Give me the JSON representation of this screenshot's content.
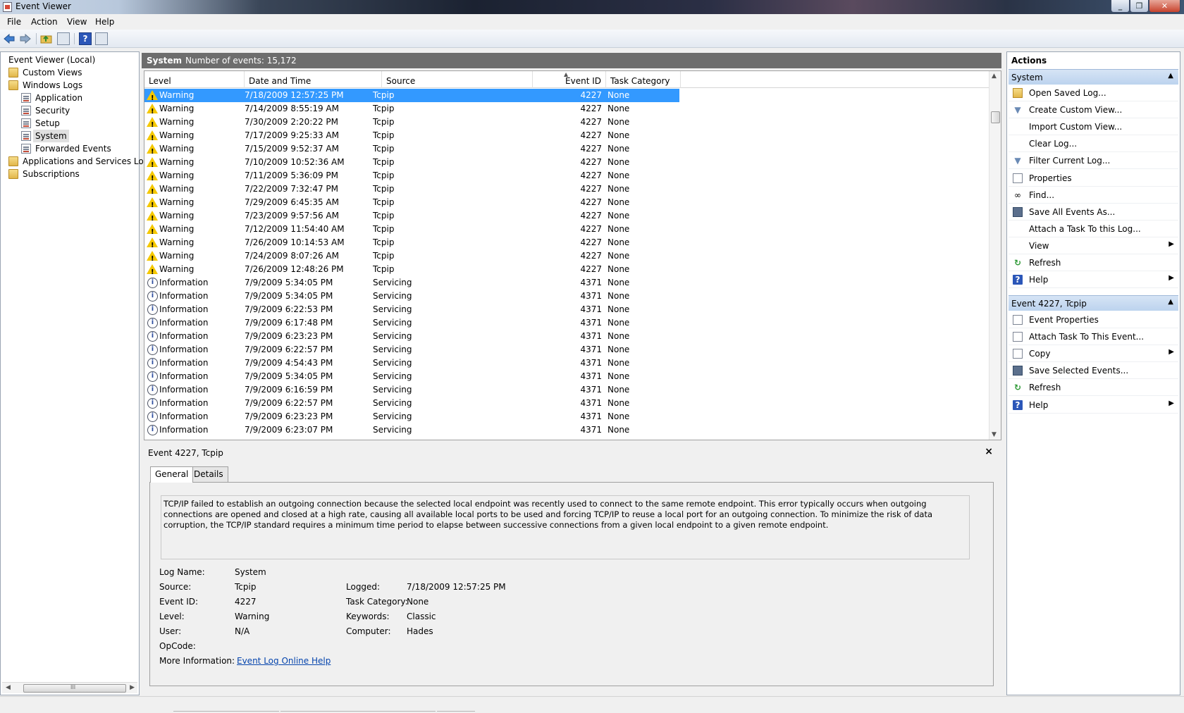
{
  "window": {
    "title": "Event Viewer"
  },
  "menu": [
    "File",
    "Action",
    "View",
    "Help"
  ],
  "toolbar": [
    "back-icon",
    "forward-icon",
    "up-folder-icon",
    "show-tree-icon",
    "help-icon",
    "show-action-pane-icon"
  ],
  "tree": {
    "root": "Event Viewer (Local)",
    "custom_views": "Custom Views",
    "windows_logs": "Windows Logs",
    "application": "Application",
    "security": "Security",
    "setup": "Setup",
    "system": "System",
    "forwarded": "Forwarded Events",
    "apps_services": "Applications and Services Logs",
    "subscriptions": "Subscriptions",
    "scroll_grip": "III"
  },
  "header": {
    "name": "System",
    "count": "Number of events: 15,172"
  },
  "columns": {
    "level": "Level",
    "date": "Date and Time",
    "source": "Source",
    "eid": "Event ID",
    "task": "Task Category"
  },
  "events": [
    {
      "level": "Warning",
      "date": "7/18/2009 12:57:25 PM",
      "source": "Tcpip",
      "eid": "4227",
      "task": "None"
    },
    {
      "level": "Warning",
      "date": "7/14/2009 8:55:19 AM",
      "source": "Tcpip",
      "eid": "4227",
      "task": "None"
    },
    {
      "level": "Warning",
      "date": "7/30/2009 2:20:22 PM",
      "source": "Tcpip",
      "eid": "4227",
      "task": "None"
    },
    {
      "level": "Warning",
      "date": "7/17/2009 9:25:33 AM",
      "source": "Tcpip",
      "eid": "4227",
      "task": "None"
    },
    {
      "level": "Warning",
      "date": "7/15/2009 9:52:37 AM",
      "source": "Tcpip",
      "eid": "4227",
      "task": "None"
    },
    {
      "level": "Warning",
      "date": "7/10/2009 10:52:36 AM",
      "source": "Tcpip",
      "eid": "4227",
      "task": "None"
    },
    {
      "level": "Warning",
      "date": "7/11/2009 5:36:09 PM",
      "source": "Tcpip",
      "eid": "4227",
      "task": "None"
    },
    {
      "level": "Warning",
      "date": "7/22/2009 7:32:47 PM",
      "source": "Tcpip",
      "eid": "4227",
      "task": "None"
    },
    {
      "level": "Warning",
      "date": "7/29/2009 6:45:35 AM",
      "source": "Tcpip",
      "eid": "4227",
      "task": "None"
    },
    {
      "level": "Warning",
      "date": "7/23/2009 9:57:56 AM",
      "source": "Tcpip",
      "eid": "4227",
      "task": "None"
    },
    {
      "level": "Warning",
      "date": "7/12/2009 11:54:40 AM",
      "source": "Tcpip",
      "eid": "4227",
      "task": "None"
    },
    {
      "level": "Warning",
      "date": "7/26/2009 10:14:53 AM",
      "source": "Tcpip",
      "eid": "4227",
      "task": "None"
    },
    {
      "level": "Warning",
      "date": "7/24/2009 8:07:26 AM",
      "source": "Tcpip",
      "eid": "4227",
      "task": "None"
    },
    {
      "level": "Warning",
      "date": "7/26/2009 12:48:26 PM",
      "source": "Tcpip",
      "eid": "4227",
      "task": "None"
    },
    {
      "level": "Information",
      "date": "7/9/2009 5:34:05 PM",
      "source": "Servicing",
      "eid": "4371",
      "task": "None"
    },
    {
      "level": "Information",
      "date": "7/9/2009 5:34:05 PM",
      "source": "Servicing",
      "eid": "4371",
      "task": "None"
    },
    {
      "level": "Information",
      "date": "7/9/2009 6:22:53 PM",
      "source": "Servicing",
      "eid": "4371",
      "task": "None"
    },
    {
      "level": "Information",
      "date": "7/9/2009 6:17:48 PM",
      "source": "Servicing",
      "eid": "4371",
      "task": "None"
    },
    {
      "level": "Information",
      "date": "7/9/2009 6:23:23 PM",
      "source": "Servicing",
      "eid": "4371",
      "task": "None"
    },
    {
      "level": "Information",
      "date": "7/9/2009 6:22:57 PM",
      "source": "Servicing",
      "eid": "4371",
      "task": "None"
    },
    {
      "level": "Information",
      "date": "7/9/2009 4:54:43 PM",
      "source": "Servicing",
      "eid": "4371",
      "task": "None"
    },
    {
      "level": "Information",
      "date": "7/9/2009 5:34:05 PM",
      "source": "Servicing",
      "eid": "4371",
      "task": "None"
    },
    {
      "level": "Information",
      "date": "7/9/2009 6:16:59 PM",
      "source": "Servicing",
      "eid": "4371",
      "task": "None"
    },
    {
      "level": "Information",
      "date": "7/9/2009 6:22:57 PM",
      "source": "Servicing",
      "eid": "4371",
      "task": "None"
    },
    {
      "level": "Information",
      "date": "7/9/2009 6:23:23 PM",
      "source": "Servicing",
      "eid": "4371",
      "task": "None"
    },
    {
      "level": "Information",
      "date": "7/9/2009 6:23:07 PM",
      "source": "Servicing",
      "eid": "4371",
      "task": "None"
    }
  ],
  "preview": {
    "title": "Event 4227, Tcpip",
    "close": "×",
    "tabs": [
      "General",
      "Details"
    ],
    "description": "TCP/IP failed to establish an outgoing connection because the selected local endpoint was recently used to connect to the same remote endpoint. This error typically occurs when outgoing connections are opened and closed at a high rate, causing all available local ports to be used and forcing TCP/IP to reuse a local port for an outgoing connection. To minimize the risk of data corruption, the TCP/IP standard requires a minimum time period to elapse between successive connections from a given local endpoint to a given remote endpoint.",
    "fields": {
      "log_name_label": "Log Name:",
      "log_name": "System",
      "source_label": "Source:",
      "source": "Tcpip",
      "logged_label": "Logged:",
      "logged": "7/18/2009 12:57:25 PM",
      "event_id_label": "Event ID:",
      "event_id": "4227",
      "task_label": "Task Category:",
      "task": "None",
      "level_label": "Level:",
      "level": "Warning",
      "keywords_label": "Keywords:",
      "keywords": "Classic",
      "user_label": "User:",
      "user": "N/A",
      "computer_label": "Computer:",
      "computer": "Hades",
      "opcode_label": "OpCode:",
      "opcode": "",
      "more_label": "More Information:",
      "more_link": "Event Log Online Help"
    }
  },
  "actions": {
    "title": "Actions",
    "section1": "System",
    "section1_items": [
      {
        "label": "Open Saved Log...",
        "icon": "open-log-icon",
        "sub": false
      },
      {
        "label": "Create Custom View...",
        "icon": "filter-icon",
        "sub": false
      },
      {
        "label": "Import Custom View...",
        "icon": "",
        "sub": false
      },
      {
        "label": "Clear Log...",
        "icon": "",
        "sub": false
      },
      {
        "label": "Filter Current Log...",
        "icon": "filter-icon",
        "sub": false
      },
      {
        "label": "Properties",
        "icon": "properties-icon",
        "sub": false
      },
      {
        "label": "Find...",
        "icon": "binoculars-icon",
        "sub": false
      },
      {
        "label": "Save All Events As...",
        "icon": "save-icon",
        "sub": false
      },
      {
        "label": "Attach a Task To this Log...",
        "icon": "",
        "sub": false
      },
      {
        "label": "View",
        "icon": "",
        "sub": true
      },
      {
        "label": "Refresh",
        "icon": "refresh-icon",
        "sub": false
      },
      {
        "label": "Help",
        "icon": "help-icon",
        "sub": true
      }
    ],
    "section2": "Event 4227, Tcpip",
    "section2_items": [
      {
        "label": "Event Properties",
        "icon": "properties-icon",
        "sub": false
      },
      {
        "label": "Attach Task To This Event...",
        "icon": "task-icon",
        "sub": false
      },
      {
        "label": "Copy",
        "icon": "copy-icon",
        "sub": true
      },
      {
        "label": "Save Selected Events...",
        "icon": "save-icon",
        "sub": false
      },
      {
        "label": "Refresh",
        "icon": "refresh-icon",
        "sub": false
      },
      {
        "label": "Help",
        "icon": "help-icon",
        "sub": true
      }
    ]
  }
}
